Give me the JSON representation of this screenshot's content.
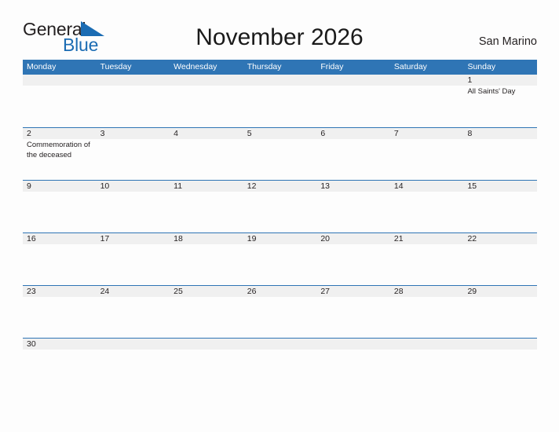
{
  "brand": {
    "name_part1": "General",
    "name_part2": "Blue",
    "flag_icon": "blue-flag-triangle",
    "color_dark": "#231f20",
    "color_blue": "#1b6cb3"
  },
  "header": {
    "title": "November 2026",
    "locale": "San Marino"
  },
  "theme": {
    "header_blue": "#2f75b5",
    "band_gray": "#f0f0f0",
    "text_dark": "#231f20",
    "page_bg": "#fdfdfd"
  },
  "calendar": {
    "weekdays": [
      "Monday",
      "Tuesday",
      "Wednesday",
      "Thursday",
      "Friday",
      "Saturday",
      "Sunday"
    ],
    "weeks": [
      {
        "days": [
          {
            "num": "",
            "events": []
          },
          {
            "num": "",
            "events": []
          },
          {
            "num": "",
            "events": []
          },
          {
            "num": "",
            "events": []
          },
          {
            "num": "",
            "events": []
          },
          {
            "num": "",
            "events": []
          },
          {
            "num": "1",
            "events": [
              "All Saints' Day"
            ]
          }
        ]
      },
      {
        "days": [
          {
            "num": "2",
            "events": [
              "Commemoration of the deceased"
            ]
          },
          {
            "num": "3",
            "events": []
          },
          {
            "num": "4",
            "events": []
          },
          {
            "num": "5",
            "events": []
          },
          {
            "num": "6",
            "events": []
          },
          {
            "num": "7",
            "events": []
          },
          {
            "num": "8",
            "events": []
          }
        ]
      },
      {
        "days": [
          {
            "num": "9",
            "events": []
          },
          {
            "num": "10",
            "events": []
          },
          {
            "num": "11",
            "events": []
          },
          {
            "num": "12",
            "events": []
          },
          {
            "num": "13",
            "events": []
          },
          {
            "num": "14",
            "events": []
          },
          {
            "num": "15",
            "events": []
          }
        ]
      },
      {
        "days": [
          {
            "num": "16",
            "events": []
          },
          {
            "num": "17",
            "events": []
          },
          {
            "num": "18",
            "events": []
          },
          {
            "num": "19",
            "events": []
          },
          {
            "num": "20",
            "events": []
          },
          {
            "num": "21",
            "events": []
          },
          {
            "num": "22",
            "events": []
          }
        ]
      },
      {
        "days": [
          {
            "num": "23",
            "events": []
          },
          {
            "num": "24",
            "events": []
          },
          {
            "num": "25",
            "events": []
          },
          {
            "num": "26",
            "events": []
          },
          {
            "num": "27",
            "events": []
          },
          {
            "num": "28",
            "events": []
          },
          {
            "num": "29",
            "events": []
          }
        ]
      },
      {
        "days": [
          {
            "num": "30",
            "events": []
          },
          {
            "num": "",
            "events": []
          },
          {
            "num": "",
            "events": []
          },
          {
            "num": "",
            "events": []
          },
          {
            "num": "",
            "events": []
          },
          {
            "num": "",
            "events": []
          },
          {
            "num": "",
            "events": []
          }
        ]
      }
    ]
  }
}
